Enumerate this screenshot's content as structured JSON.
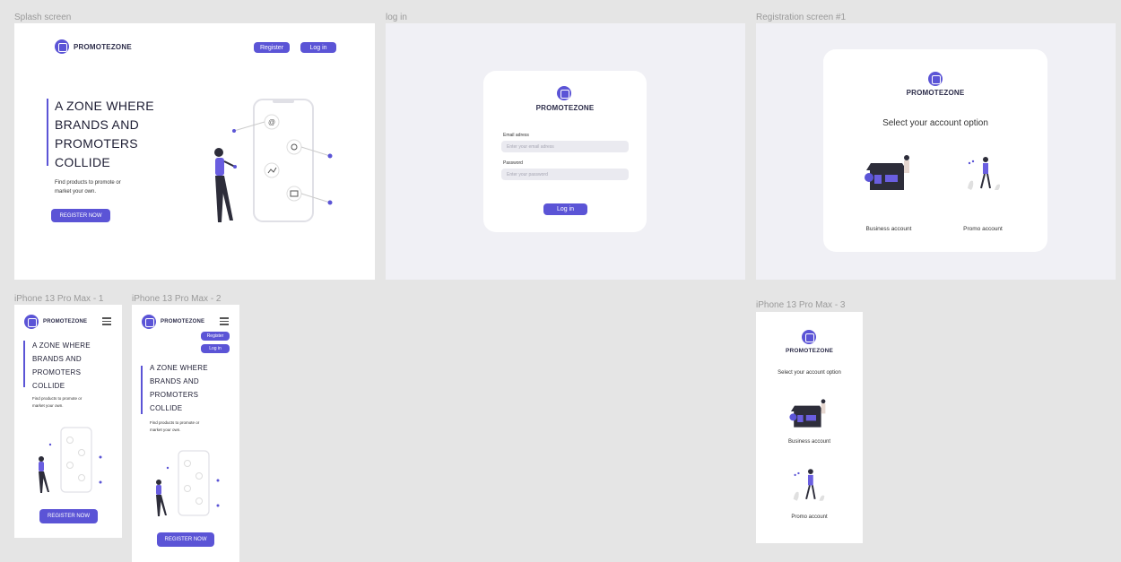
{
  "frames": {
    "splash": "Splash screen",
    "login": "log in",
    "registration": "Registration screen #1",
    "iphone1": "iPhone 13 Pro Max - 1",
    "iphone2": "iPhone 13 Pro Max - 2",
    "iphone3": "iPhone 13 Pro Max - 3"
  },
  "brand": "PROMOTEZONE",
  "nav": {
    "register": "Register",
    "login": "Log in"
  },
  "hero": {
    "line1": "A ZONE WHERE",
    "line2": "BRANDS AND",
    "line3": "PROMOTERS",
    "line4": "COLLIDE",
    "sub1": "Find products to promote or",
    "sub2": "market your own.",
    "cta": "REGISTER NOW"
  },
  "login": {
    "email_label": "Email adress",
    "email_placeholder": "Enter your email adress",
    "password_label": "Password",
    "password_placeholder": "Enter your password",
    "submit": "Log in"
  },
  "registration": {
    "title": "Select your account option",
    "business": "Business account",
    "promo": "Promo account"
  },
  "colors": {
    "accent": "#5b54d6",
    "canvas": "#e5e5e5",
    "panel": "#f0f0f5"
  }
}
